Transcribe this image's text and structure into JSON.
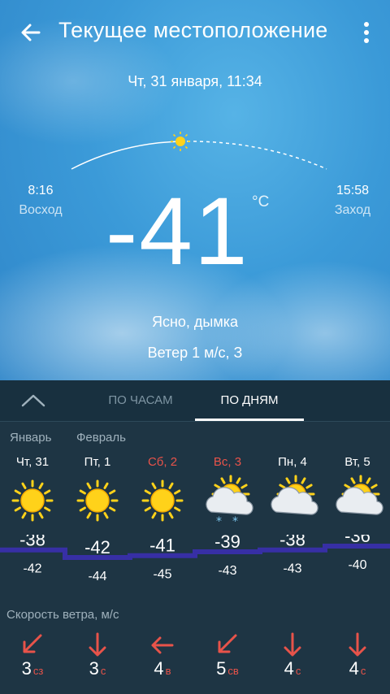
{
  "appbar": {
    "title": "Текущее местоположение",
    "back_icon": "back-arrow-icon",
    "menu_icon": "more-vert-icon"
  },
  "current": {
    "date": "Чт, 31 января, 11:34",
    "temperature": "-41",
    "unit": "°C",
    "sunrise_time": "8:16",
    "sunrise_label": "Восход",
    "sunset_time": "15:58",
    "sunset_label": "Заход",
    "condition": "Ясно, дымка",
    "wind": "Ветер 1 м/с, З"
  },
  "tabs": {
    "collapse_icon": "chevron-up-icon",
    "hourly": "ПО ЧАСАМ",
    "daily": "ПО ДНЯМ",
    "active": "daily"
  },
  "months": [
    "Январь",
    "Февраль"
  ],
  "days": [
    {
      "label": "Чт, 31",
      "weekend": false,
      "icon": "sun-icon",
      "high": "-38",
      "low": "-42",
      "wind_speed": "3",
      "wind_dir": "сз",
      "wind_arrow": "arrow-down-left-icon"
    },
    {
      "label": "Пт, 1",
      "weekend": false,
      "icon": "sun-icon",
      "high": "-42",
      "low": "-44",
      "wind_speed": "3",
      "wind_dir": "с",
      "wind_arrow": "arrow-down-icon"
    },
    {
      "label": "Сб, 2",
      "weekend": true,
      "icon": "sun-icon",
      "high": "-41",
      "low": "-45",
      "wind_speed": "4",
      "wind_dir": "в",
      "wind_arrow": "arrow-left-icon"
    },
    {
      "label": "Вс, 3",
      "weekend": true,
      "icon": "partly-cloudy-snow-icon",
      "high": "-39",
      "low": "-43",
      "wind_speed": "5",
      "wind_dir": "св",
      "wind_arrow": "arrow-down-left-icon"
    },
    {
      "label": "Пн, 4",
      "weekend": false,
      "icon": "partly-cloudy-icon",
      "high": "-38",
      "low": "-43",
      "wind_speed": "4",
      "wind_dir": "с",
      "wind_arrow": "arrow-down-icon"
    },
    {
      "label": "Вт, 5",
      "weekend": false,
      "icon": "partly-cloudy-icon",
      "high": "-36",
      "low": "-40",
      "wind_speed": "4",
      "wind_dir": "с",
      "wind_arrow": "arrow-down-icon"
    }
  ],
  "wind_section_label": "Скорость ветра, м/с",
  "colors": {
    "sky": "#3b9ad8",
    "panel": "#1e3544",
    "weekend": "#e8534a",
    "temp_band": "#3a2fb0",
    "sun": "#ffd21a"
  }
}
